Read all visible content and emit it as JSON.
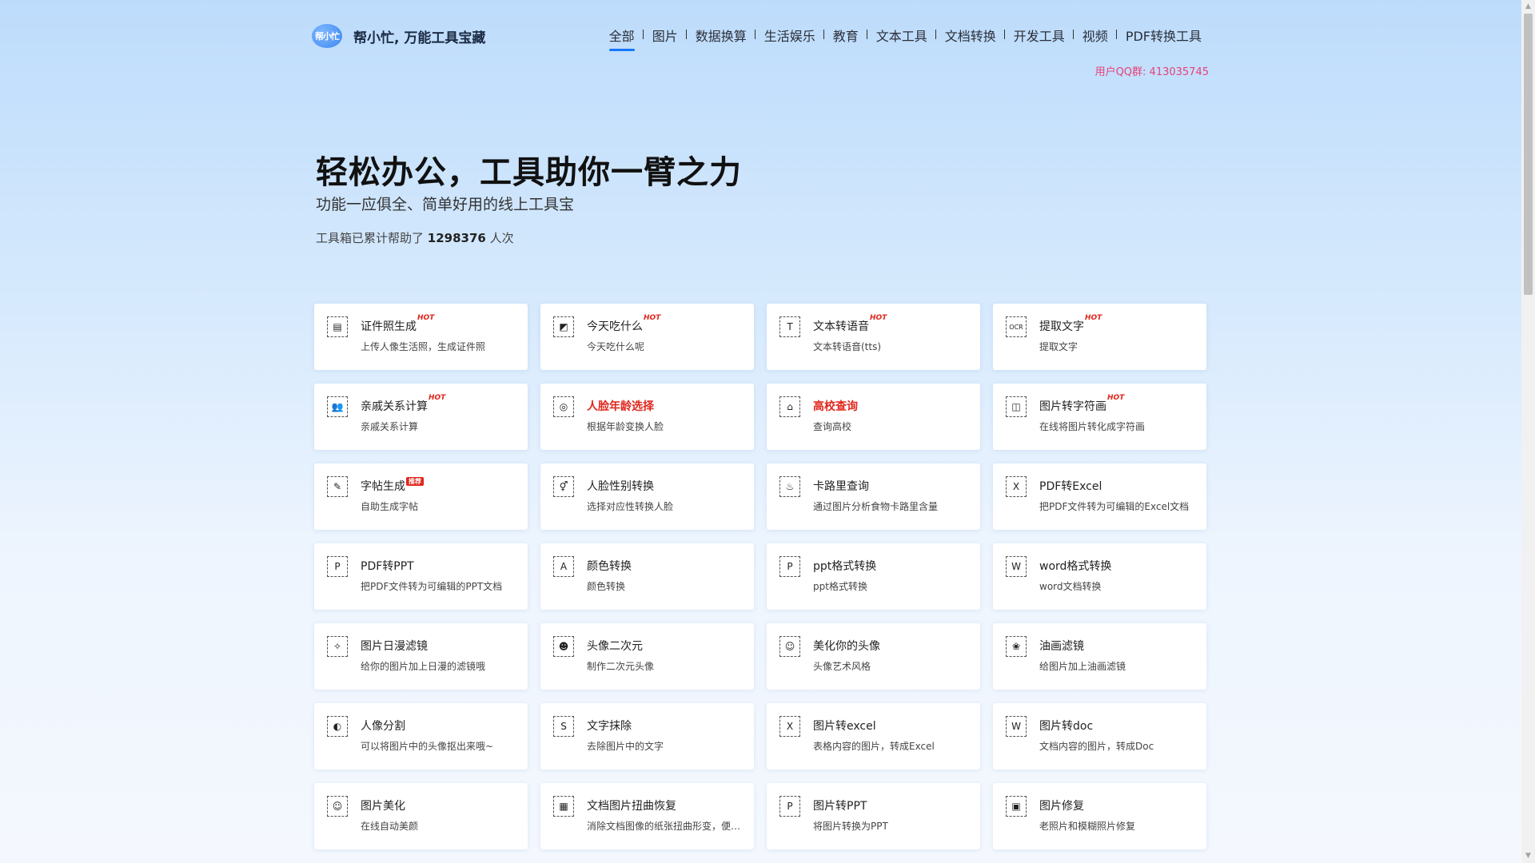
{
  "header": {
    "logo_mark": "帮小忙",
    "logo_text": "帮小忙, 万能工具宝藏",
    "nav": [
      "全部",
      "图片",
      "数据换算",
      "生活娱乐",
      "教育",
      "文本工具",
      "文档转换",
      "开发工具",
      "视频",
      "PDF转换工具"
    ],
    "qq": "用户QQ群: 413035745"
  },
  "hero": {
    "title": "轻松办公，工具助你一臂之力",
    "subtitle": "功能一应俱全、简单好用的线上工具宝",
    "stat_prefix": "工具箱已累计帮助了",
    "stat_count": "1298376",
    "stat_suffix": "人次"
  },
  "tools": [
    {
      "title": "证件照生成",
      "desc": "上传人像生活照，生成证件照",
      "badge": "HOT",
      "icon": "id-card-icon",
      "glyph": "▤"
    },
    {
      "title": "今天吃什么",
      "desc": "今天吃什么呢",
      "badge": "HOT",
      "icon": "food-icon",
      "glyph": "◩"
    },
    {
      "title": "文本转语音",
      "desc": "文本转语音(tts)",
      "badge": "HOT",
      "icon": "text-to-speech-icon",
      "glyph": "T"
    },
    {
      "title": "提取文字",
      "desc": "提取文字",
      "badge": "HOT",
      "icon": "ocr-icon",
      "glyph": "OCR"
    },
    {
      "title": "亲戚关系计算",
      "desc": "亲戚关系计算",
      "badge": "HOT",
      "icon": "relatives-icon",
      "glyph": "👥"
    },
    {
      "title": "人脸年龄选择",
      "desc": "根据年龄变换人脸",
      "badge": "",
      "icon": "face-age-icon",
      "glyph": "◎",
      "red": true
    },
    {
      "title": "高校查询",
      "desc": "查询高校",
      "badge": "",
      "icon": "university-icon",
      "glyph": "⌂",
      "red": true
    },
    {
      "title": "图片转字符画",
      "desc": "在线将图片转化成字符画",
      "badge": "HOT",
      "icon": "ascii-art-icon",
      "glyph": "◫"
    },
    {
      "title": "字帖生成",
      "desc": "自助生成字帖",
      "badge": "推荐",
      "icon": "copybook-icon",
      "glyph": "✎"
    },
    {
      "title": "人脸性别转换",
      "desc": "选择对应性转换人脸",
      "badge": "",
      "icon": "gender-swap-icon",
      "glyph": "⚥"
    },
    {
      "title": "卡路里查询",
      "desc": "通过图片分析食物卡路里含量",
      "badge": "",
      "icon": "calorie-icon",
      "glyph": "♨"
    },
    {
      "title": "PDF转Excel",
      "desc": "把PDF文件转为可编辑的Excel文档",
      "badge": "",
      "icon": "pdf-excel-icon",
      "glyph": "X"
    },
    {
      "title": "PDF转PPT",
      "desc": "把PDF文件转为可编辑的PPT文档",
      "badge": "",
      "icon": "pdf-ppt-icon",
      "glyph": "P"
    },
    {
      "title": "颜色转换",
      "desc": "颜色转换",
      "badge": "",
      "icon": "color-convert-icon",
      "glyph": "A"
    },
    {
      "title": "ppt格式转换",
      "desc": "ppt格式转换",
      "badge": "",
      "icon": "ppt-format-icon",
      "glyph": "P"
    },
    {
      "title": "word格式转换",
      "desc": "word文档转换",
      "badge": "",
      "icon": "word-format-icon",
      "glyph": "W"
    },
    {
      "title": "图片日漫滤镜",
      "desc": "给你的图片加上日漫的滤镜哦",
      "badge": "",
      "icon": "anime-filter-icon",
      "glyph": "✧"
    },
    {
      "title": "头像二次元",
      "desc": "制作二次元头像",
      "badge": "",
      "icon": "anime-avatar-icon",
      "glyph": "☻"
    },
    {
      "title": "美化你的头像",
      "desc": "头像艺术风格",
      "badge": "",
      "icon": "beautify-avatar-icon",
      "glyph": "☺"
    },
    {
      "title": "油画滤镜",
      "desc": "给图片加上油画滤镜",
      "badge": "",
      "icon": "oil-painting-icon",
      "glyph": "❀"
    },
    {
      "title": "人像分割",
      "desc": "可以将图片中的头像抠出来哦~",
      "badge": "",
      "icon": "portrait-segment-icon",
      "glyph": "◐"
    },
    {
      "title": "文字抹除",
      "desc": "去除图片中的文字",
      "badge": "",
      "icon": "text-erase-icon",
      "glyph": "S"
    },
    {
      "title": "图片转excel",
      "desc": "表格内容的图片，转成Excel",
      "badge": "",
      "icon": "image-excel-icon",
      "glyph": "X"
    },
    {
      "title": "图片转doc",
      "desc": "文档内容的图片，转成Doc",
      "badge": "",
      "icon": "image-doc-icon",
      "glyph": "W"
    },
    {
      "title": "图片美化",
      "desc": "在线自动美颜",
      "badge": "",
      "icon": "image-beautify-icon",
      "glyph": "☺"
    },
    {
      "title": "文档图片扭曲恢复",
      "desc": "消除文档图像的纸张扭曲形变，便于阅读",
      "badge": "",
      "icon": "doc-dewarp-icon",
      "glyph": "▦"
    },
    {
      "title": "图片转PPT",
      "desc": "将图片转换为PPT",
      "badge": "",
      "icon": "image-ppt-icon",
      "glyph": "P"
    },
    {
      "title": "图片修复",
      "desc": "老照片和模糊照片修复",
      "badge": "",
      "icon": "image-repair-icon",
      "glyph": "▣"
    }
  ]
}
